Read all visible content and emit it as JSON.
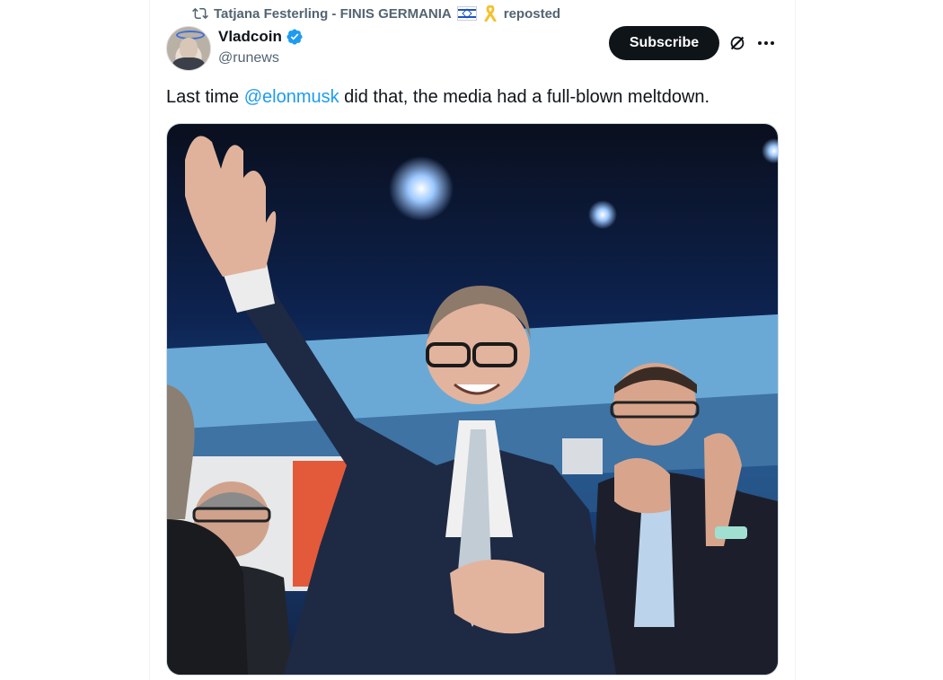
{
  "repost": {
    "icon": "repost-icon",
    "user": "Tatjana Festerling - FINIS GERMANIA",
    "emoji": [
      "israel-flag-icon",
      "yellow-ribbon-icon"
    ],
    "suffix": "reposted"
  },
  "author": {
    "display_name": "Vladcoin",
    "handle": "@runews",
    "verified": true,
    "verified_color": "#1d9bf0"
  },
  "actions": {
    "subscribe_label": "Subscribe",
    "grok_icon": "grok-icon",
    "more_icon": "more-icon"
  },
  "tweet": {
    "text_before": "Last time ",
    "mention": "@elonmusk",
    "text_after": " did that, the media had a full-blown meltdown.",
    "mention_color": "#1d9bf0"
  },
  "media": {
    "type": "photo"
  }
}
